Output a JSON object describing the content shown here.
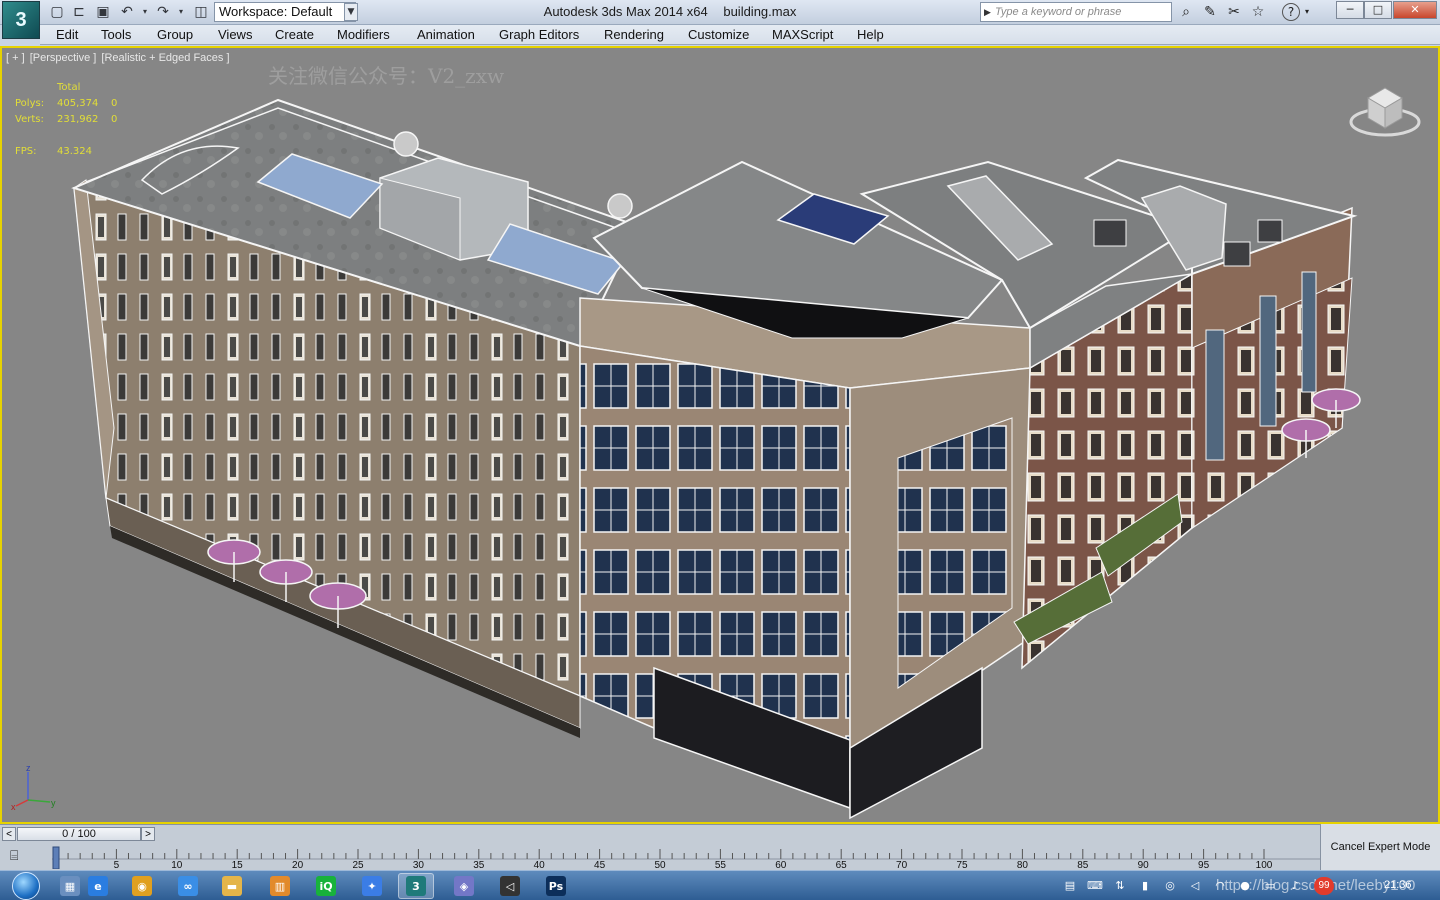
{
  "window": {
    "title": "Autodesk 3ds Max  2014 x64",
    "filename": "building.max",
    "logo_glyph": "3"
  },
  "quick_access": {
    "icons": [
      "new-file-icon",
      "open-file-icon",
      "save-icon",
      "undo-icon",
      "undo-dropdown-icon",
      "redo-icon",
      "redo-dropdown-icon",
      "project-folder-icon"
    ]
  },
  "workspace": {
    "value": "Workspace: Default"
  },
  "search": {
    "placeholder": "Type a keyword or phrase"
  },
  "titlebar_tools": {
    "icons": [
      "binoculars-icon",
      "communication-center-icon",
      "favorites-icon",
      "star-icon",
      "help-icon"
    ]
  },
  "window_controls": {
    "minimize": "─",
    "maximize": "□",
    "close": "✕"
  },
  "menu": {
    "items": [
      "Edit",
      "Tools",
      "Group",
      "Views",
      "Create",
      "Modifiers",
      "Animation",
      "Graph Editors",
      "Rendering",
      "Customize",
      "MAXScript",
      "Help"
    ]
  },
  "viewport": {
    "label_parts": [
      "[ + ]",
      "[Perspective ]",
      "[Realistic + Edged Faces ]"
    ],
    "stats": {
      "header": "Total",
      "polys_label": "Polys:",
      "polys_value": "405,374",
      "polys_sel": "0",
      "verts_label": "Verts:",
      "verts_value": "231,962",
      "verts_sel": "0",
      "fps_label": "FPS:",
      "fps_value": "43.324"
    },
    "watermark": "关注微信公众号：V2_zxw",
    "viewcube_text": "ViewCube",
    "axis": {
      "x": "x",
      "y": "y",
      "z": "z"
    },
    "background": "#868686",
    "border_color": "#e6d200"
  },
  "timeline": {
    "frame_display": "0 / 100",
    "current_frame": 0,
    "ticks": [
      "5",
      "10",
      "15",
      "20",
      "25",
      "30",
      "35",
      "40",
      "45",
      "50",
      "55",
      "60",
      "65",
      "70",
      "75",
      "80",
      "85",
      "90",
      "95",
      "100"
    ],
    "cancel_label": "Cancel Expert Mode"
  },
  "taskbar": {
    "apps": [
      {
        "name": "file-explorer-tool",
        "glyph": "▦",
        "color": "#6a8fbf"
      },
      {
        "name": "internet-explorer",
        "glyph": "e",
        "color": "#2a7de1"
      },
      {
        "name": "chrome",
        "glyph": "◉",
        "color": "#e0a020"
      },
      {
        "name": "baidu-netdisk",
        "glyph": "∞",
        "color": "#3a8ee6"
      },
      {
        "name": "folder",
        "glyph": "▬",
        "color": "#e4b54a"
      },
      {
        "name": "chart-app",
        "glyph": "▥",
        "color": "#e28a2b"
      },
      {
        "name": "iqiyi",
        "glyph": "iQ",
        "color": "#18b23b"
      },
      {
        "name": "wechat-work",
        "glyph": "✦",
        "color": "#3b7de6"
      },
      {
        "name": "3ds-max",
        "glyph": "3",
        "color": "#1f7a7a"
      },
      {
        "name": "vmware",
        "glyph": "◈",
        "color": "#7377c7"
      },
      {
        "name": "unity",
        "glyph": "◁",
        "color": "#333333"
      },
      {
        "name": "photoshop",
        "glyph": "Ps",
        "color": "#0c2e5a"
      }
    ],
    "tray_icons": [
      "pdf-tray-icon",
      "keyboard-tray-icon",
      "usb-tray-icon",
      "battery-tray-icon",
      "vmware-tray-icon",
      "send-tray-icon",
      "wifi-tray-icon",
      "chrome-tray-icon",
      "monitor-tray-icon",
      "volume-tray-icon"
    ],
    "badge": "99",
    "clock": "21:36",
    "blog_watermark": "https://blog.csdn.net/leeby100"
  }
}
